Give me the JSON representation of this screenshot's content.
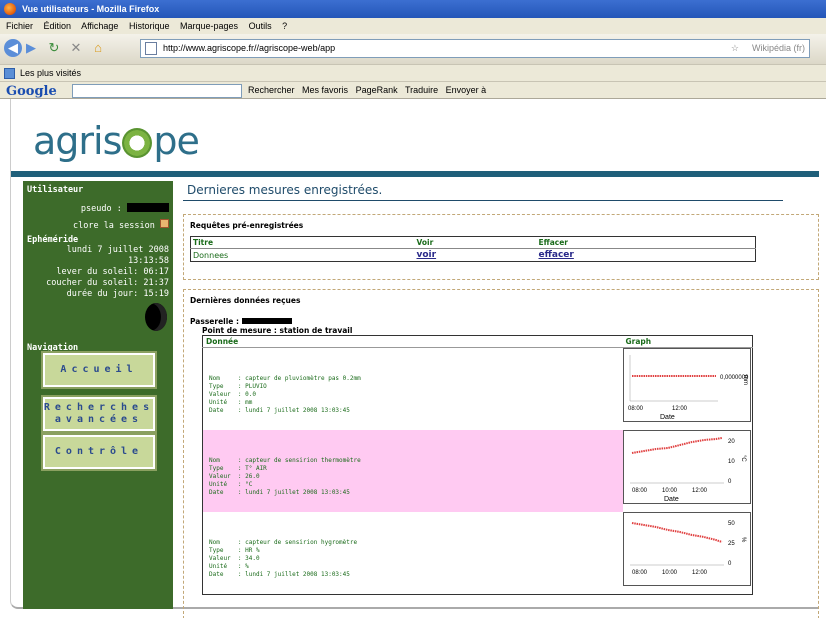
{
  "window": {
    "title": "Vue utilisateurs - Mozilla Firefox"
  },
  "menubar": [
    "Fichier",
    "Édition",
    "Affichage",
    "Historique",
    "Marque-pages",
    "Outils",
    "?"
  ],
  "navbar": {
    "url": "http://www.agriscope.fr//agriscope-web/app",
    "search_engine": "Wikipédia (fr)"
  },
  "bookmarks": {
    "label": "Les plus visités"
  },
  "googlebar": {
    "logo": "Google",
    "items": [
      "Rechercher",
      "Mes favoris",
      "PageRank",
      "Traduire",
      "Envoyer à"
    ]
  },
  "site": {
    "logo": "agriscope"
  },
  "sidebar": {
    "utilisateur_title": "Utilisateur",
    "pseudo_label": "pseudo :",
    "logout": "clore la session",
    "ephemeride_title": "Ephéméride",
    "date": "lundi 7 juillet 2008",
    "time": "13:13:58",
    "sunrise": "lever du soleil: 06:17",
    "sunset": "coucher du soleil: 21:37",
    "daylength": "durée du jour: 15:19",
    "navigation_title": "Navigation",
    "btn_accueil": "Accueil",
    "btn_recherches_1": "Recherches",
    "btn_recherches_2": "avancées",
    "btn_controle": "Contrôle"
  },
  "main": {
    "title": "Dernieres mesures enregistrées.",
    "requetes": {
      "title": "Requêtes pré-enregistrées",
      "headers": [
        "Titre",
        "Voir",
        "Effacer"
      ],
      "row": {
        "titre": "Donnees",
        "voir": "voir",
        "effacer": "effacer"
      }
    },
    "donnees": {
      "title": "Dernières données reçues",
      "passerelle_label": "Passerelle :",
      "point_label": "Point de mesure : station de travail",
      "headers": [
        "Donnée",
        "Graph"
      ],
      "rows": [
        {
          "desc": "Nom     : capteur de pluviomètre pas 0.2mm\nType    : PLUVIO\nValeur  : 0.0\nUnité   : mm\nDate    : lundi 7 juillet 2008 13:03:45"
        },
        {
          "desc": "Nom     : capteur de sensirion thermomètre\nType    : T° AIR\nValeur  : 26.0\nUnité   : °C\nDate    : lundi 7 juillet 2008 13:03:45"
        },
        {
          "desc": "Nom     : capteur de sensirion hygromètre\nType    : HR %\nValeur  : 34.0\nUnité   : %\nDate    : lundi 7 juillet 2008 13:03:45"
        }
      ],
      "graphs": [
        {
          "y_ticks": [
            "0,0000000"
          ],
          "unit": "mm",
          "x_ticks": [
            "08:00",
            "12:00"
          ],
          "xlabel": "Date"
        },
        {
          "y_ticks": [
            "20",
            "10",
            "0"
          ],
          "unit": "°C",
          "x_ticks": [
            "08:00",
            "10:00",
            "12:00"
          ],
          "xlabel": "Date"
        },
        {
          "y_ticks": [
            "50",
            "25",
            "0"
          ],
          "unit": "%",
          "x_ticks": [
            "08:00",
            "10:00",
            "12:00"
          ],
          "xlabel": ""
        }
      ]
    }
  },
  "colors": {
    "sidebar": "#3d6b2a",
    "accent": "#1f5f7a",
    "pink_row": "#ffcaf2",
    "series": "#e04040"
  }
}
